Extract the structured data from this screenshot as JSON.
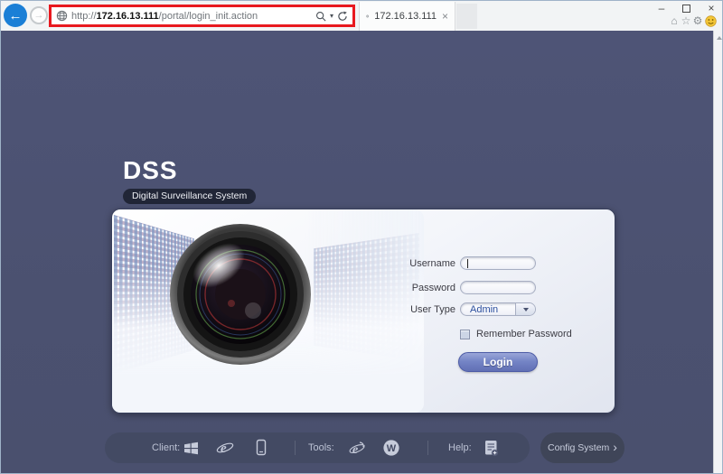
{
  "browser": {
    "url": {
      "scheme": "http://",
      "domain": "172.16.13.111",
      "path": "/portal/login_init.action"
    },
    "tab": {
      "title": "172.16.13.111"
    },
    "glyphs": {
      "back": "←",
      "forward": "→",
      "search_caret": "▾",
      "tab_close": "×",
      "minimize": "–",
      "close": "×",
      "home": "⌂",
      "favorites": "☆",
      "settings": "⚙"
    },
    "annotation_color": "#e8191f"
  },
  "page": {
    "logo": {
      "title": "DSS",
      "subtitle": "Digital Surveillance System"
    },
    "form": {
      "username_label": "Username",
      "username_value": "",
      "password_label": "Password",
      "password_value": "",
      "user_type_label": "User Type",
      "user_type_value": "Admin",
      "remember_label": "Remember Password",
      "remember_checked": false,
      "login_label": "Login"
    },
    "footer": {
      "client_label": "Client:",
      "tools_label": "Tools:",
      "help_label": "Help:",
      "config_label": "Config System",
      "config_chevron": "›"
    },
    "icons": {
      "client": [
        "windows-icon",
        "ie-browser-icon",
        "mobile-phone-icon"
      ],
      "tools": [
        "ie-tool-icon",
        "w-console-icon"
      ],
      "help": [
        "help-document-icon"
      ]
    },
    "colors": {
      "page_bg": "#4b5170",
      "panel_border": "#39405c",
      "footer_pill": "#434a63",
      "config_pill": "#3f4558",
      "login_button": "#7585c6",
      "user_type_text": "#2c4f9e",
      "annotation_red": "#e8191f"
    }
  }
}
